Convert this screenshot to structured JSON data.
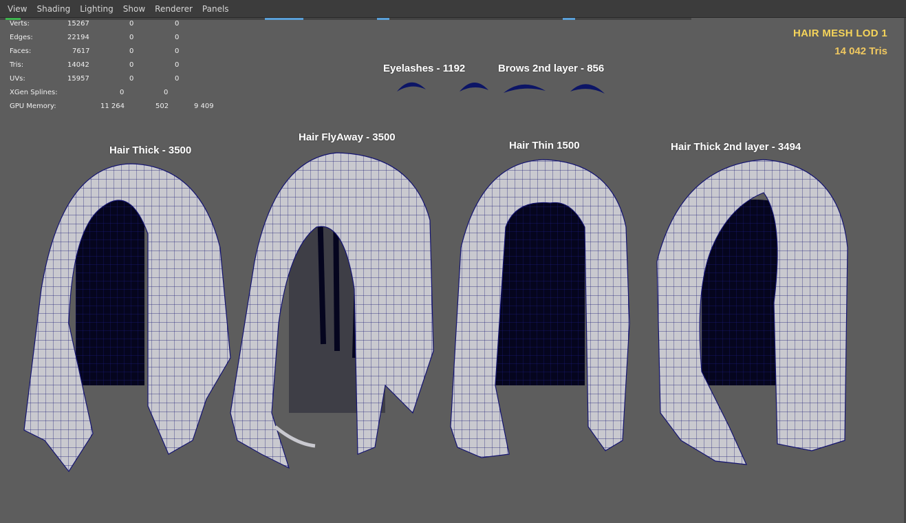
{
  "menu": [
    "View",
    "Shading",
    "Lighting",
    "Show",
    "Renderer",
    "Panels"
  ],
  "hud": {
    "rows": [
      {
        "label": "Verts:",
        "v1": "15267",
        "v2": "0",
        "v3": "0"
      },
      {
        "label": "Edges:",
        "v1": "22194",
        "v2": "0",
        "v3": "0"
      },
      {
        "label": "Faces:",
        "v1": "7617",
        "v2": "0",
        "v3": "0"
      },
      {
        "label": "Tris:",
        "v1": "14042",
        "v2": "0",
        "v3": "0"
      },
      {
        "label": "UVs:",
        "v1": "15957",
        "v2": "0",
        "v3": "0"
      },
      {
        "label": "XGen Splines:",
        "v1": "",
        "v2": "0",
        "v3": "0"
      },
      {
        "label": "GPU Memory:",
        "v1": "11 264",
        "v2": "502",
        "v3": "9 409"
      }
    ]
  },
  "lod": {
    "title": "HAIR MESH LOD 1",
    "tris": "14 042 Tris"
  },
  "labels": {
    "eyelashes": "Eyelashes - 1192",
    "brows": "Brows 2nd layer - 856",
    "hair_thick": "Hair Thick - 3500",
    "hair_flyaway": "Hair FlyAway - 3500",
    "hair_thin": "Hair Thin 1500",
    "hair_thick_2nd": "Hair Thick 2nd layer - 3494"
  },
  "colors": {
    "viewport_bg": "#5d5d5d",
    "wire": "#141470",
    "mesh_fill": "#c9c9cf",
    "mesh_inner": "#05051e",
    "lod_title": "#f5d45a"
  }
}
